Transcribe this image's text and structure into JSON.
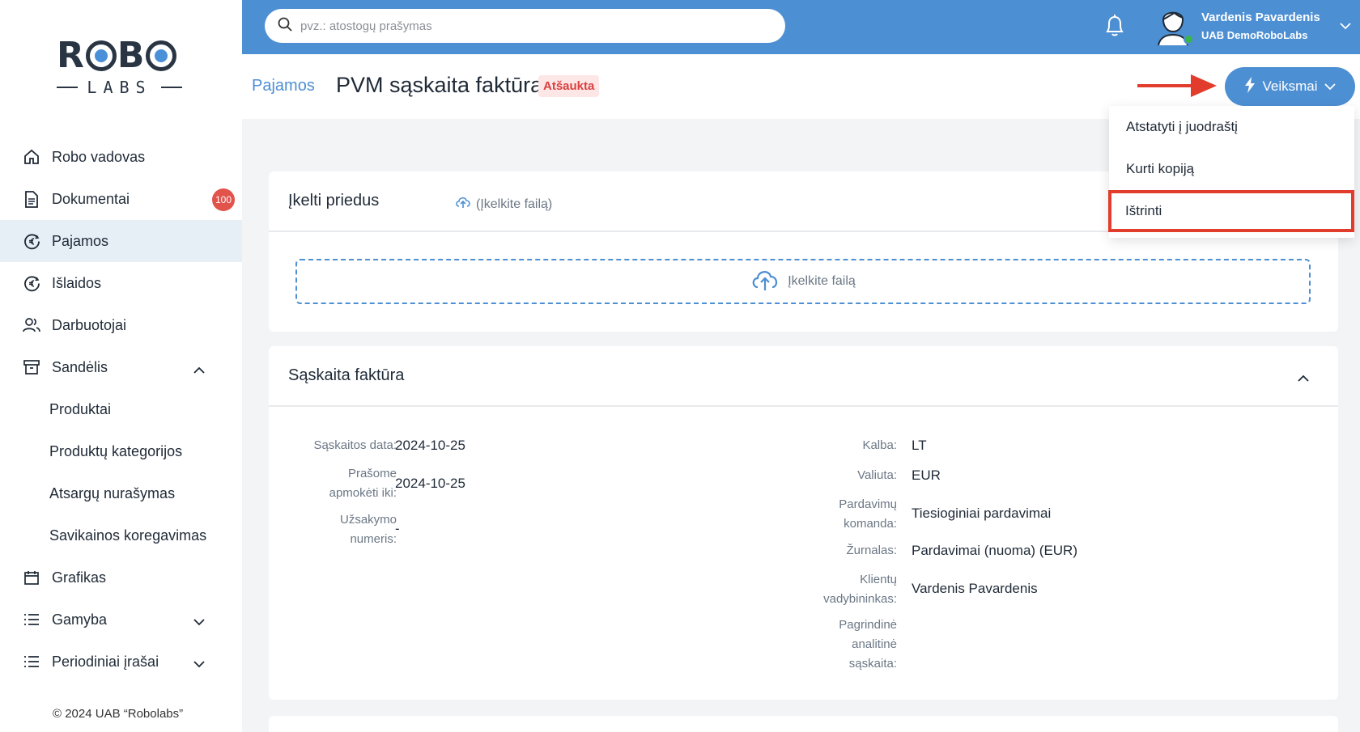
{
  "brand": {
    "logo_top": "ROBO",
    "logo_bottom": "LABS"
  },
  "sidebar": {
    "items": [
      {
        "label": "Robo vadovas",
        "icon": "home-icon"
      },
      {
        "label": "Dokumentai",
        "icon": "document-icon",
        "badge": "100"
      },
      {
        "label": "Pajamos",
        "icon": "euro-circle-icon",
        "active": true
      },
      {
        "label": "Išlaidos",
        "icon": "euro-circle-icon"
      },
      {
        "label": "Darbuotojai",
        "icon": "users-icon"
      },
      {
        "label": "Sandėlis",
        "icon": "archive-icon",
        "chevron": "chevron-up-icon"
      },
      {
        "label": "Produktai",
        "sub": true
      },
      {
        "label": "Produktų kategorijos",
        "sub": true
      },
      {
        "label": "Atsargų nurašymas",
        "sub": true
      },
      {
        "label": "Savikainos koregavimas",
        "sub": true
      },
      {
        "label": "Grafikas",
        "icon": "calendar-icon"
      },
      {
        "label": "Gamyba",
        "icon": "list-icon",
        "chevron": "chevron-down-icon"
      },
      {
        "label": "Periodiniai įrašai",
        "icon": "list-icon",
        "chevron": "chevron-down-icon"
      }
    ],
    "copyright": "© 2024 UAB “Robolabs”"
  },
  "topbar": {
    "search_placeholder": "pvz.: atostogų prašymas",
    "user_name": "Vardenis Pavardenis",
    "user_company": "UAB DemoRoboLabs",
    "accent": "#4d8fd3"
  },
  "header": {
    "breadcrumb": "Pajamos",
    "title": "PVM sąskaita faktūra",
    "status": "Atšaukta",
    "actions_label": "Veiksmai"
  },
  "actions_menu": {
    "items": [
      "Atstatyti į juodraštį",
      "Kurti kopiją",
      "Ištrinti"
    ]
  },
  "attachments": {
    "title": "Įkelti priedus",
    "upload_link": "(Įkelkite failą)",
    "dropzone": "Įkelkite failą"
  },
  "invoice": {
    "title": "Sąskaita faktūra",
    "left": [
      {
        "label": "Sąskaitos data:",
        "value": "2024-10-25"
      },
      {
        "label": "Prašome apmokėti iki:",
        "value": "2024-10-25"
      },
      {
        "label": "Užsakymo numeris:",
        "value": "-"
      }
    ],
    "right": [
      {
        "label": "Kalba:",
        "value": "LT"
      },
      {
        "label": "Valiuta:",
        "value": "EUR"
      },
      {
        "label": "Pardavimų komanda:",
        "value": "Tiesioginiai pardavimai"
      },
      {
        "label": "Žurnalas:",
        "value": "Pardavimai (nuoma) (EUR)"
      },
      {
        "label": "Klientų vadybininkas:",
        "value": "Vardenis Pavardenis"
      },
      {
        "label": "Pagrindinė analitinė sąskaita:",
        "value": ""
      }
    ]
  }
}
